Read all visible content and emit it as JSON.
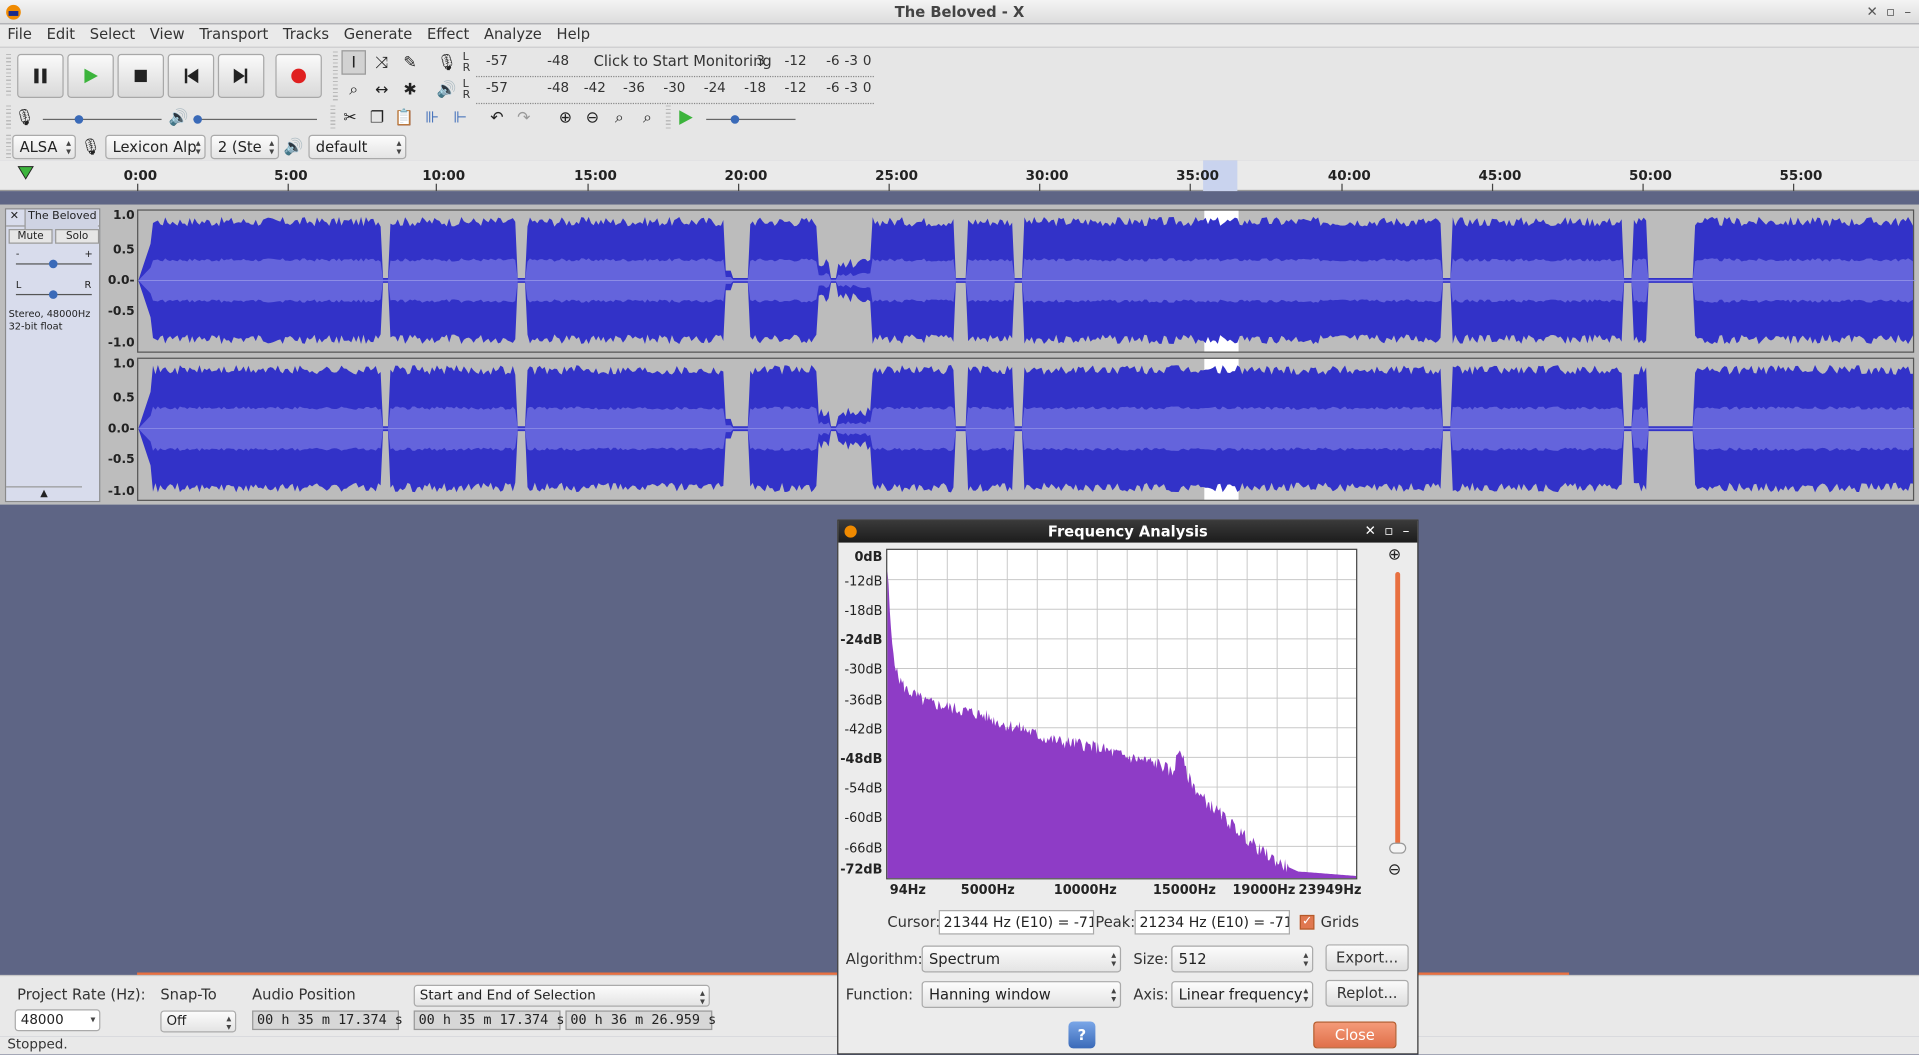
{
  "window": {
    "title": "The Beloved - X"
  },
  "menu": [
    "File",
    "Edit",
    "Select",
    "View",
    "Transport",
    "Tracks",
    "Generate",
    "Effect",
    "Analyze",
    "Help"
  ],
  "meters": {
    "record_scale": [
      "-57",
      "-48",
      "Click to Start Monitoring",
      "3",
      "-12",
      "-6",
      "-3",
      "0"
    ],
    "play_scale": [
      "-57",
      "-48",
      "-42",
      "-36",
      "-30",
      "-24",
      "-18",
      "-12",
      "-6",
      "-3",
      "0"
    ],
    "lr": [
      "L",
      "R"
    ]
  },
  "devices": {
    "host": "ALSA",
    "input": "Lexicon Alp",
    "channels": "2 (Ste",
    "output": "default"
  },
  "ruler": {
    "ticks": [
      "0:00",
      "5:00",
      "10:00",
      "15:00",
      "20:00",
      "25:00",
      "30:00",
      "35:00",
      "40:00",
      "45:00",
      "50:00",
      "55:00"
    ]
  },
  "track": {
    "name": "The Beloved",
    "mute": "Mute",
    "solo": "Solo",
    "gain_minus": "-",
    "gain_plus": "+",
    "pan_l": "L",
    "pan_r": "R",
    "info": "Stereo, 48000Hz\n32-bit float",
    "scale": [
      "1.0",
      "0.5",
      "0.0-",
      "-0.5",
      "-1.0"
    ]
  },
  "bottom": {
    "project_rate_label": "Project Rate (Hz):",
    "project_rate": "48000",
    "snap_to_label": "Snap-To",
    "snap_to": "Off",
    "audio_position_label": "Audio Position",
    "audio_position": "00 h 35 m 17.374 s",
    "selection_mode": "Start and End of Selection",
    "sel_start": "00 h 35 m 17.374 s",
    "sel_end": "00 h 36 m 26.959 s",
    "status": "Stopped."
  },
  "freq_dialog": {
    "title": "Frequency Analysis",
    "db_labels": [
      "0dB",
      "-12dB",
      "-18dB",
      "-24dB",
      "-30dB",
      "-36dB",
      "-42dB",
      "-48dB",
      "-54dB",
      "-60dB",
      "-66dB",
      "-72dB"
    ],
    "hz_labels": [
      "94Hz",
      "5000Hz",
      "10000Hz",
      "15000Hz",
      "19000Hz",
      "23949Hz"
    ],
    "cursor_label": "Cursor:",
    "cursor": "21344 Hz (E10) = -71",
    "peak_label": "Peak:",
    "peak": "21234 Hz (E10) = -71",
    "grids_label": "Grids",
    "grids": true,
    "algorithm_label": "Algorithm:",
    "algorithm": "Spectrum",
    "size_label": "Size:",
    "size": "512",
    "function_label": "Function:",
    "function": "Hanning window",
    "axis_label": "Axis:",
    "axis": "Linear frequency",
    "export": "Export...",
    "replot": "Replot...",
    "help": "?",
    "close": "Close",
    "spectrum_color": "#8e3cc6"
  },
  "colors": {
    "waveform_dark": "#3232c8",
    "waveform_light": "#6464dc",
    "accent_record": "#e02020",
    "play_green": "#3cb43c"
  }
}
